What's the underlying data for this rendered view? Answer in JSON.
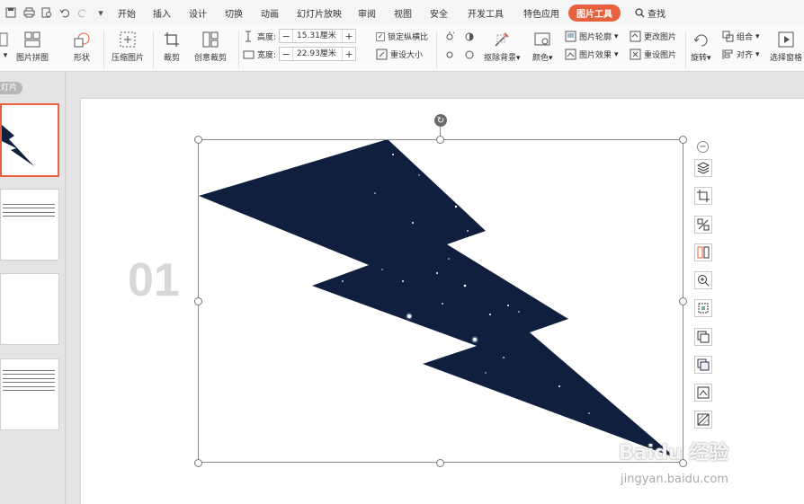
{
  "menu": {
    "items": [
      "开始",
      "插入",
      "设计",
      "切换",
      "动画",
      "幻灯片放映",
      "审阅",
      "视图",
      "安全",
      "开发工具",
      "特色应用",
      "图片工具"
    ],
    "search": "查找",
    "accent_color": "#e8613f"
  },
  "ribbon": {
    "picture_collage": "图片拼图",
    "shape": "形状",
    "compress": "压缩图片",
    "crop": "裁剪",
    "creative_crop": "创意裁剪",
    "height_label": "高度:",
    "height_value": "15.31厘米",
    "width_label": "宽度:",
    "width_value": "22.93厘米",
    "lock_ratio": "锁定纵横比",
    "reset_size": "重设大小",
    "remove_bg": "抠除背景",
    "color": "颜色",
    "outline": "图片轮廓",
    "effect": "图片效果",
    "change_pic": "更改图片",
    "reset_pic": "重设图片",
    "group": "组合",
    "rotate": "旋转",
    "align": "对齐",
    "selection_pane": "选择窗格"
  },
  "panel": {
    "label": "灯片"
  },
  "slide": {
    "number": "01",
    "shape_color": "#0f1f3d"
  },
  "watermark": {
    "brand": "Baidu 经验",
    "url": "jingyan.baidu.com"
  }
}
